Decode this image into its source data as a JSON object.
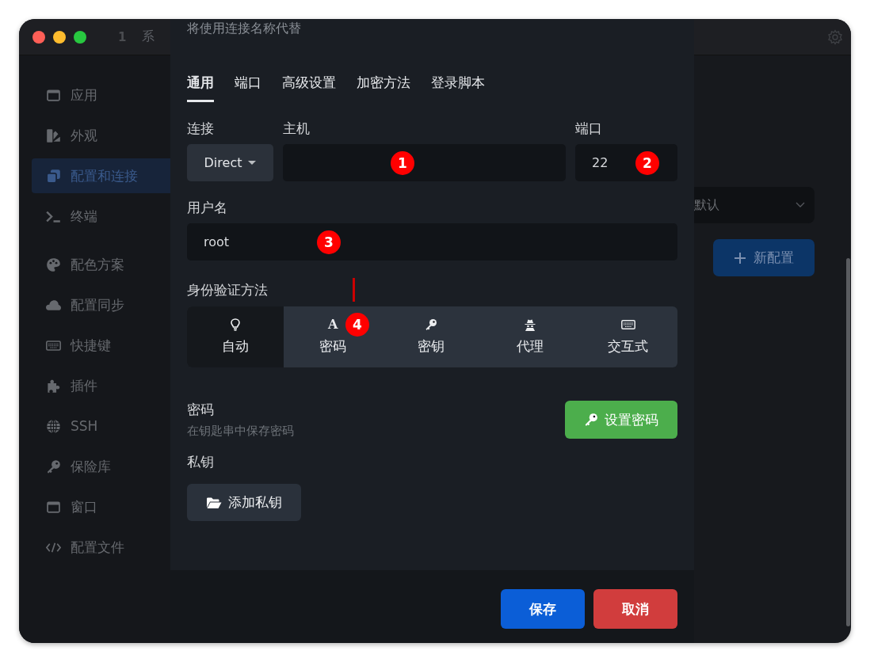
{
  "titlebar": {
    "tab_number": "1",
    "tab_title": "系"
  },
  "sidebar": {
    "groups": [
      {
        "items": [
          {
            "label": "应用",
            "selected": false
          },
          {
            "label": "外观",
            "selected": false
          },
          {
            "label": "配置和连接",
            "selected": true
          },
          {
            "label": "终端",
            "selected": false
          }
        ]
      },
      {
        "items": [
          {
            "label": "配色方案",
            "selected": false
          },
          {
            "label": "配置同步",
            "selected": false
          },
          {
            "label": "快捷键",
            "selected": false
          },
          {
            "label": "插件",
            "selected": false
          },
          {
            "label": "SSH",
            "selected": false
          },
          {
            "label": "保险库",
            "selected": false
          },
          {
            "label": "窗口",
            "selected": false
          },
          {
            "label": "配置文件",
            "selected": false
          }
        ]
      }
    ]
  },
  "background": {
    "profile_select": {
      "value": "默认"
    },
    "new_profile_button": "新配置"
  },
  "dialog": {
    "hint": "将使用连接名称代替",
    "tabs": [
      {
        "label": "通用",
        "selected": true
      },
      {
        "label": "端口",
        "selected": false
      },
      {
        "label": "高级设置",
        "selected": false
      },
      {
        "label": "加密方法",
        "selected": false
      },
      {
        "label": "登录脚本",
        "selected": false
      }
    ],
    "connection": {
      "label": "连接",
      "value": "Direct"
    },
    "host": {
      "label": "主机",
      "marker": "1"
    },
    "port": {
      "label": "端口",
      "value": "22",
      "marker": "2"
    },
    "username": {
      "label": "用户名",
      "value": "root",
      "marker": "3"
    },
    "auth": {
      "label": "身份验证方法",
      "options": [
        {
          "label": "自动",
          "selected": true
        },
        {
          "label": "密码",
          "glyph": "A",
          "selected": false,
          "marker": "4"
        },
        {
          "label": "密钥",
          "selected": false
        },
        {
          "label": "代理",
          "selected": false
        },
        {
          "label": "交互式",
          "selected": false
        }
      ]
    },
    "password": {
      "label": "密码",
      "description": "在钥匙串中保存密码",
      "button": "设置密码"
    },
    "private_key": {
      "label": "私钥",
      "button": "添加私钥"
    },
    "footer": {
      "save": "保存",
      "cancel": "取消"
    }
  }
}
